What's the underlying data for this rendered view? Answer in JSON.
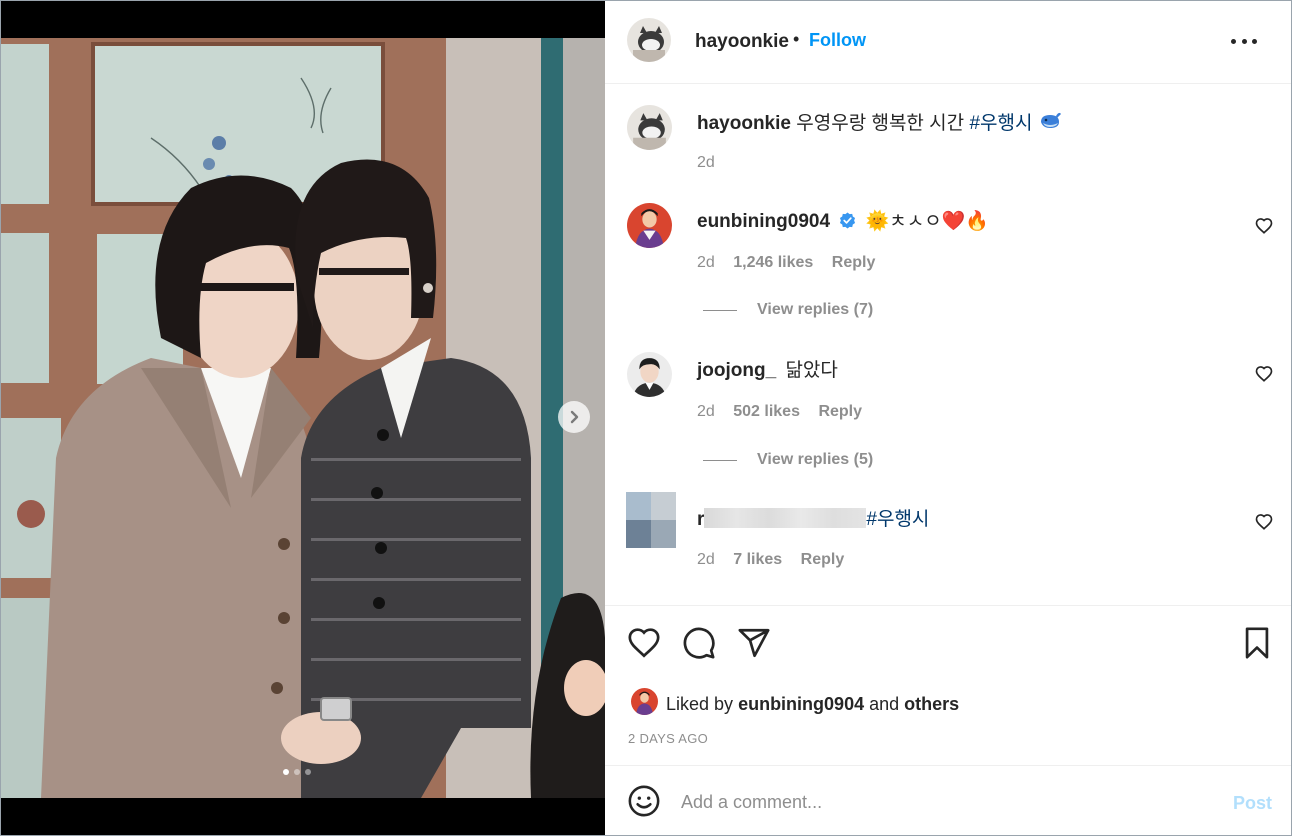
{
  "post": {
    "author": "hayoonkie",
    "separator": "•",
    "follow_label": "Follow",
    "more_icon": "more-horizontal-icon",
    "caption": {
      "username": "hayoonkie",
      "text": "우영우랑 행복한 시간",
      "hashtag": "#우행시",
      "emoji": "whale-emoji",
      "time": "2d"
    },
    "carousel": {
      "next_icon": "chevron-right-icon",
      "slides": 3,
      "current": 1
    }
  },
  "comments": [
    {
      "username": "eunbining0904",
      "verified": true,
      "text": "🌞ㅊㅅㅇ❤️🔥",
      "time": "2d",
      "likes": "1,246 likes",
      "reply_label": "Reply",
      "view_replies": "View replies (7)"
    },
    {
      "username": "joojong_",
      "verified": false,
      "text": "닮았다",
      "time": "2d",
      "likes": "502 likes",
      "reply_label": "Reply",
      "view_replies": "View replies (5)"
    },
    {
      "username": "r",
      "verified": false,
      "text": "#우행시",
      "time": "2d",
      "likes": "7 likes",
      "reply_label": "Reply"
    }
  ],
  "actions": {
    "icons": [
      "heart-icon",
      "comment-icon",
      "share-icon",
      "bookmark-icon"
    ],
    "liked_by_prefix": "Liked by",
    "liked_by_user": "eunbining0904",
    "liked_by_and": "and",
    "liked_by_others": "others",
    "time_ago": "2 DAYS AGO"
  },
  "composer": {
    "placeholder": "Add a comment...",
    "post_label": "Post",
    "emoji_icon": "smile-icon"
  },
  "colors": {
    "accent": "#0095f6",
    "hashtag": "#00376b",
    "muted": "#8e8e8e",
    "verified": "#3897f0",
    "post_disabled": "#b2dffc"
  }
}
